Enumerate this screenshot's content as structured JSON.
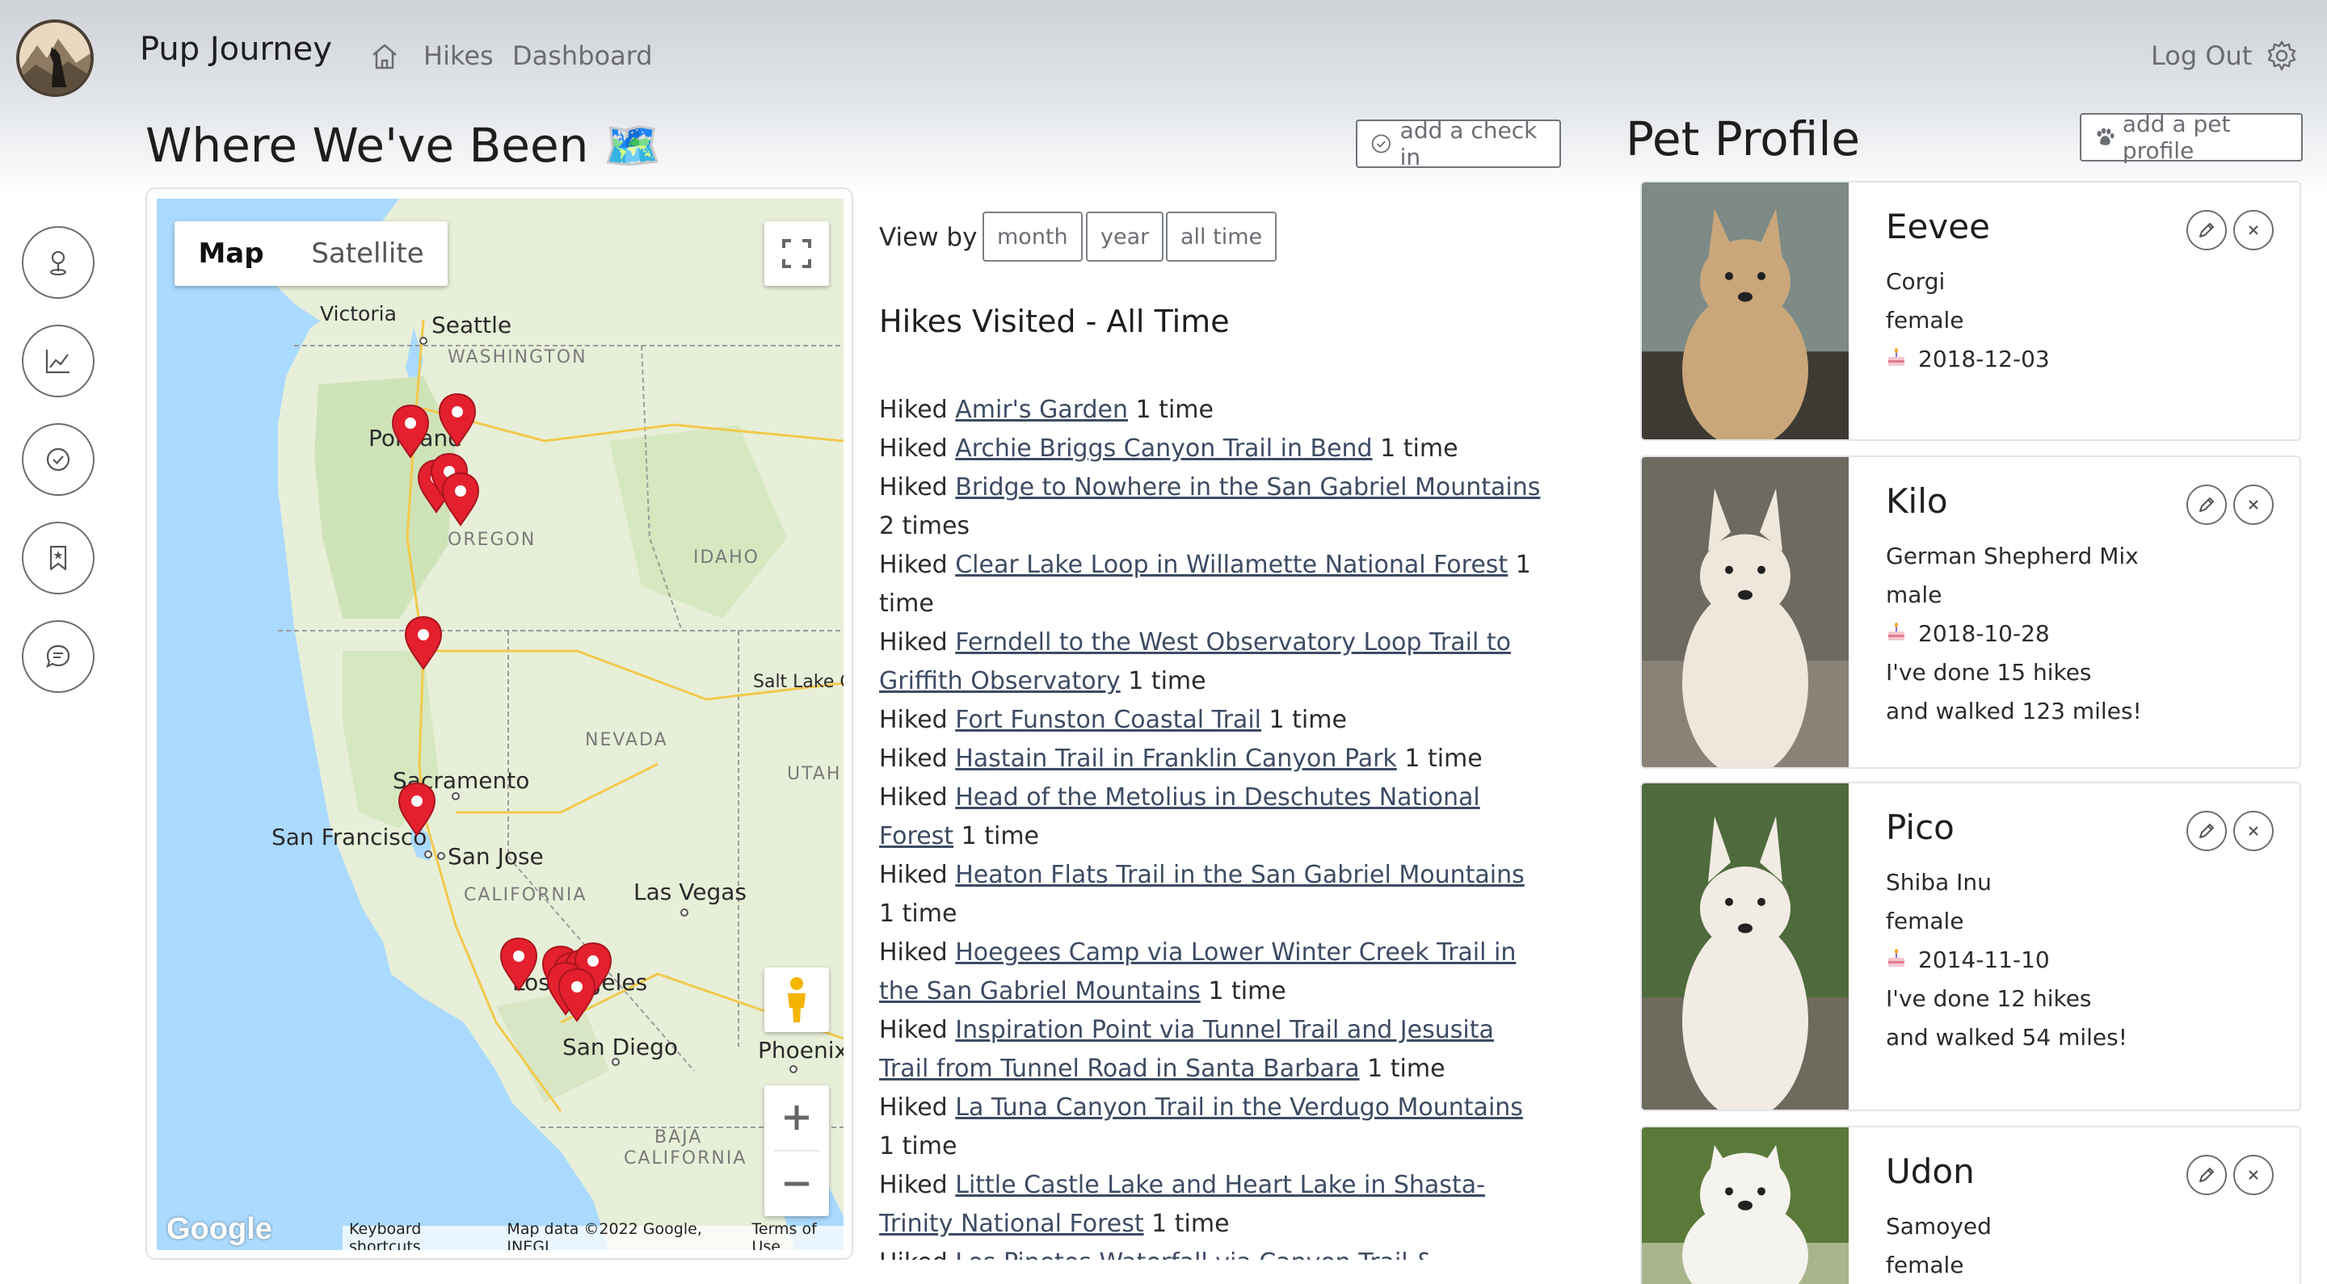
{
  "nav": {
    "brand": "Pup Journey",
    "links": [
      "Hikes",
      "Dashboard"
    ],
    "logout": "Log Out",
    "icons": [
      "home-icon",
      "gear-icon"
    ]
  },
  "rail": {
    "icons": [
      "map-pin-icon",
      "chart-icon",
      "check-circle-icon",
      "bookmark-icon",
      "chat-icon"
    ]
  },
  "where": {
    "title": "Where We've Been 🗺️",
    "add_checkin": "add a check in"
  },
  "map": {
    "type_map": "Map",
    "type_satellite": "Satellite",
    "footer": [
      "Keyboard shortcuts",
      "Map data ©2022 Google, INEGI",
      "Terms of Use"
    ],
    "google": "Google",
    "labels": {
      "victoria": "Victoria",
      "seattle": "Seattle",
      "washington": "WASHINGTON",
      "portland": "Portland",
      "oregon": "OREGON",
      "idaho": "IDAHO",
      "salt_lake": "Salt Lake Ci",
      "nevada": "NEVADA",
      "utah": "UTAH",
      "sacramento": "Sacramento",
      "san_francisco": "San Francisco",
      "san_jose": "San Jose",
      "california": "CALIFORNIA",
      "las_vegas": "Las Vegas",
      "los_angeles": "Los Angeles",
      "san_diego": "San Diego",
      "phoenix": "Phoenix",
      "baja": "BAJA",
      "baja_ca": "CALIFORNIA"
    },
    "colors": {
      "water": "#aadaff",
      "land": "#e8efd9",
      "pin": "#e4202f"
    }
  },
  "viewby": {
    "label": "View by",
    "options": [
      "month",
      "year",
      "all time"
    ]
  },
  "hikes": {
    "heading": "Hikes Visited - All Time",
    "prefix": "Hiked",
    "items": [
      {
        "name": "Amir's Garden",
        "count": "1 time"
      },
      {
        "name": "Archie Briggs Canyon Trail in Bend",
        "count": "1 time"
      },
      {
        "name": "Bridge to Nowhere in the San Gabriel Mountains",
        "count": "2 times"
      },
      {
        "name": "Clear Lake Loop in Willamette National Forest",
        "count": "1 time"
      },
      {
        "name": "Ferndell to the West Observatory Loop Trail to Griffith Observatory",
        "count": "1 time"
      },
      {
        "name": "Fort Funston Coastal Trail",
        "count": "1 time"
      },
      {
        "name": "Hastain Trail in Franklin Canyon Park",
        "count": "1 time"
      },
      {
        "name": "Head of the Metolius in Deschutes National Forest",
        "count": "1 time"
      },
      {
        "name": "Heaton Flats Trail in the San Gabriel Mountains",
        "count": "1 time"
      },
      {
        "name": "Hoegees Camp via Lower Winter Creek Trail in the San Gabriel Mountains",
        "count": "1 time"
      },
      {
        "name": "Inspiration Point via Tunnel Trail and Jesusita Trail from Tunnel Road in Santa Barbara",
        "count": "1 time"
      },
      {
        "name": "La Tuna Canyon Trail in the Verdugo Mountains",
        "count": "1 time"
      },
      {
        "name": "Little Castle Lake and Heart Lake in Shasta-Trinity National Forest",
        "count": "1 time"
      },
      {
        "name": "Los Pinetos Waterfall via Canyon Trail & Waterfall",
        "count": ""
      }
    ]
  },
  "pets": {
    "title": "Pet Profile",
    "add_label": "add a pet profile",
    "items": [
      {
        "name": "Eevee",
        "breed": "Corgi",
        "gender": "female",
        "birthday": "2018-12-03",
        "hikes": "",
        "miles": ""
      },
      {
        "name": "Kilo",
        "breed": "German Shepherd Mix",
        "gender": "male",
        "birthday": "2018-10-28",
        "hikes": "I've done 15 hikes",
        "miles": "and walked 123 miles!"
      },
      {
        "name": "Pico",
        "breed": "Shiba Inu",
        "gender": "female",
        "birthday": "2014-11-10",
        "hikes": "I've done 12 hikes",
        "miles": "and walked 54 miles!"
      },
      {
        "name": "Udon",
        "breed": "Samoyed",
        "gender": "female",
        "birthday": "",
        "hikes": "",
        "miles": ""
      }
    ]
  }
}
